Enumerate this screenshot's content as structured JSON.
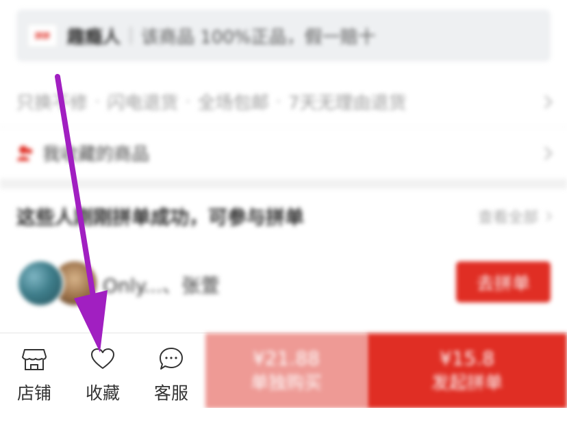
{
  "banner": {
    "logo_text": "拼拼",
    "brand": "趣瘾人",
    "text": "该商品 100%正品，假一赔十"
  },
  "services": {
    "items": [
      "只换不修",
      "闪电退货",
      "全场包邮",
      "7天无理由退货"
    ],
    "separator": "·"
  },
  "favorite_row": {
    "label": "我收藏的商品"
  },
  "group_buy": {
    "title": "这些人刚刚拼单成功，可参与拼单",
    "view_all": "查看全部",
    "names": "Only...、张萱",
    "join_label": "去拼单"
  },
  "bottom_bar": {
    "tabs": [
      {
        "label": "店铺",
        "icon": "shop-icon"
      },
      {
        "label": "收藏",
        "icon": "heart-icon"
      },
      {
        "label": "客服",
        "icon": "chat-icon"
      }
    ],
    "single_buy": {
      "price": "¥21.88",
      "label": "单独购买"
    },
    "group_buy": {
      "price": "¥15.8",
      "label": "发起拼单"
    }
  },
  "colors": {
    "accent": "#e02e24",
    "accent_light": "#ee9a95",
    "annotation_arrow": "#a11fc1"
  }
}
